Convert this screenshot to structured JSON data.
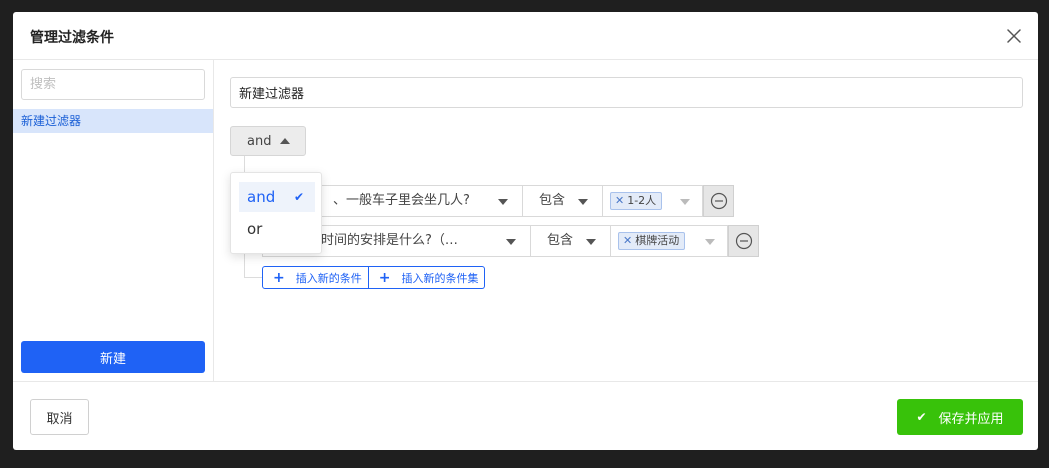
{
  "modal": {
    "title": "管理过滤条件",
    "close_icon": "close-icon"
  },
  "sidebar": {
    "search_placeholder": "搜索",
    "items": [
      {
        "label": "新建过滤器",
        "selected": true
      }
    ],
    "new_button": "新建"
  },
  "main": {
    "filter_name": "新建过滤器",
    "logic": "and",
    "logic_dropdown": {
      "open": true,
      "options": [
        {
          "label": "and",
          "selected": true
        },
        {
          "label": "or",
          "selected": false
        }
      ]
    },
    "conditions": [
      {
        "question": "、一般车子里会坐几人?",
        "operator": "包含",
        "values": [
          "1-2人"
        ]
      },
      {
        "question": "时间的安排是什么?（…",
        "operator": "包含",
        "values": [
          "棋牌活动"
        ]
      }
    ],
    "add_condition": "插入新的条件",
    "add_condition_set": "插入新的条件集"
  },
  "footer": {
    "cancel": "取消",
    "save": "保存并应用"
  },
  "colors": {
    "primary": "#1f62f5",
    "success": "#38c20a",
    "selected_bg": "#d8e5fb"
  }
}
